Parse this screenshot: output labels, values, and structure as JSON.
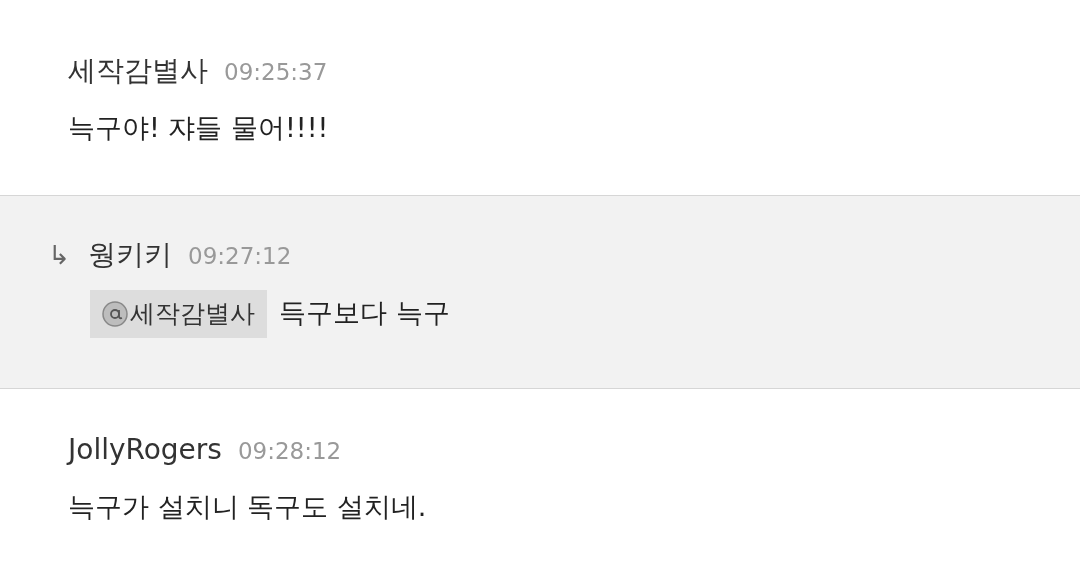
{
  "messages": [
    {
      "kind": "normal",
      "author": "세작감별사",
      "time": "09:25:37",
      "body": [
        {
          "kind": "text",
          "text": "늑구야! 쟈들 물어!!!!"
        }
      ]
    },
    {
      "kind": "reply",
      "reply_mark": "↳",
      "author": "웡키키",
      "time": "09:27:12",
      "body": [
        {
          "kind": "mention",
          "text": "세작감별사"
        },
        {
          "kind": "text",
          "text": "득구보다 늑구"
        }
      ]
    },
    {
      "kind": "normal",
      "author": "JollyRogers",
      "time": "09:28:12",
      "body": [
        {
          "kind": "text",
          "text": "늑구가 설치니 독구도 설치네."
        }
      ]
    }
  ]
}
